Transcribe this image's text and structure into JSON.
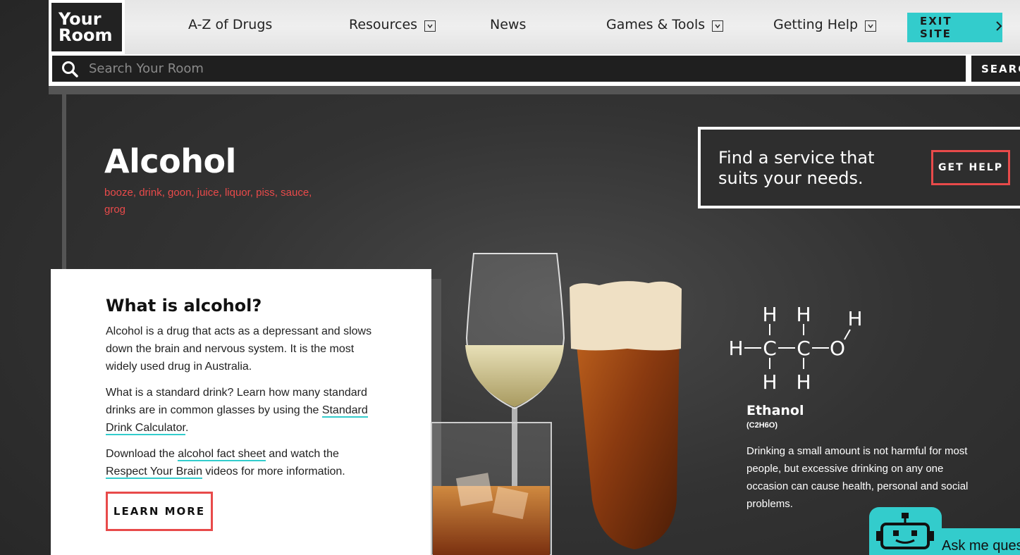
{
  "logo": {
    "line1": "Your",
    "line2": "Room"
  },
  "nav": {
    "items": [
      {
        "label": "A-Z of Drugs",
        "dropdown": false
      },
      {
        "label": "Resources",
        "dropdown": true
      },
      {
        "label": "News",
        "dropdown": false
      },
      {
        "label": "Games & Tools",
        "dropdown": true
      },
      {
        "label": "Getting Help",
        "dropdown": true
      }
    ],
    "exit_label": "EXIT SITE"
  },
  "search": {
    "placeholder": "Search Your Room",
    "button_label": "SEARCH"
  },
  "page": {
    "title": "Alcohol",
    "aliases": "booze, drink, goon, juice, liquor, piss, sauce, grog"
  },
  "help_panel": {
    "text": "Find a service that suits your needs.",
    "button_label": "GET HELP"
  },
  "card": {
    "title": "What is alcohol?",
    "p1": "Alcohol is a drug that acts as a depressant and slows down the brain and nervous system. It is the most widely used drug in Australia.",
    "p2_before": "What is a standard drink? Learn how many standard drinks are in common glasses by using the ",
    "p2_link": "Standard Drink Calculator",
    "p2_after": ".",
    "p3_before": "Download the ",
    "p3_link1": "alcohol fact sheet",
    "p3_mid": " and watch the ",
    "p3_link2": "Respect Your Brain",
    "p3_after": " videos for more information.",
    "button_label": "LEARN MORE"
  },
  "ethanol": {
    "name": "Ethanol",
    "formula": "(C2H6O)",
    "description": "Drinking a small amount is not harmful for most people, but excessive drinking on any one occasion can cause health, personal and social problems."
  },
  "chat": {
    "label": "Ask me questions"
  },
  "colors": {
    "accent": "#33cccc",
    "alert": "#e84a4a"
  }
}
